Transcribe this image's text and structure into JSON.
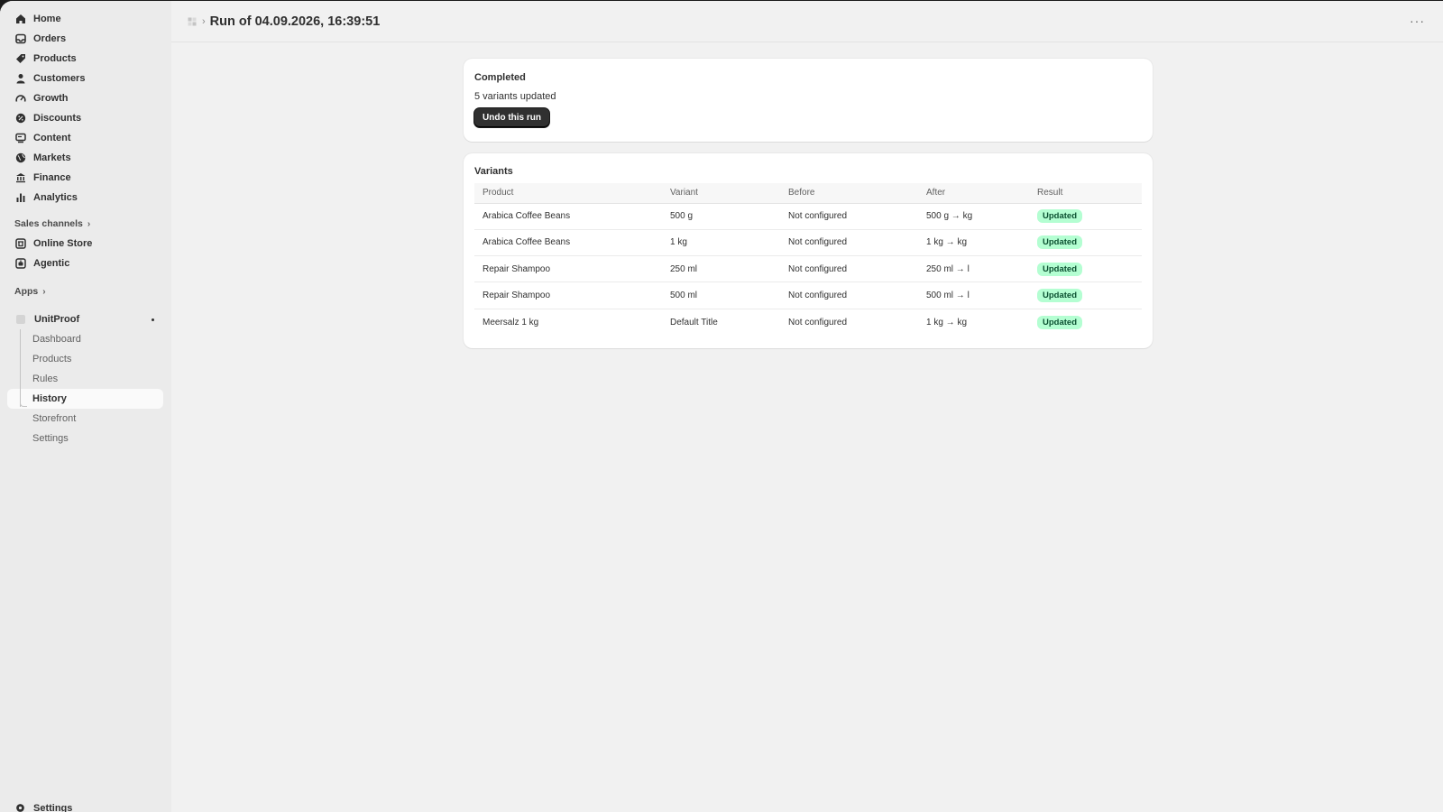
{
  "sidebar": {
    "nav": [
      {
        "label": "Home",
        "icon": "home-icon"
      },
      {
        "label": "Orders",
        "icon": "inbox-icon"
      },
      {
        "label": "Products",
        "icon": "tag-icon"
      },
      {
        "label": "Customers",
        "icon": "person-icon"
      },
      {
        "label": "Growth",
        "icon": "gauge-icon"
      },
      {
        "label": "Discounts",
        "icon": "discount-icon"
      },
      {
        "label": "Content",
        "icon": "content-icon"
      },
      {
        "label": "Markets",
        "icon": "globe-icon"
      },
      {
        "label": "Finance",
        "icon": "bank-icon"
      },
      {
        "label": "Analytics",
        "icon": "bar-chart-icon"
      }
    ],
    "sales_channels_label": "Sales channels",
    "channels": [
      {
        "label": "Online Store",
        "icon": "store-icon"
      },
      {
        "label": "Agentic",
        "icon": "agentic-icon"
      }
    ],
    "apps_label": "Apps",
    "app": {
      "name": "UnitProof",
      "items": [
        "Dashboard",
        "Products",
        "Rules",
        "History",
        "Storefront",
        "Settings"
      ],
      "active": "History"
    },
    "bottom_label": "Settings"
  },
  "header": {
    "title": "Run of 04.09.2026, 16:39:51",
    "more": "···"
  },
  "status_card": {
    "title": "Completed",
    "summary": "5 variants updated",
    "undo_label": "Undo this run"
  },
  "variants_card": {
    "title": "Variants",
    "columns": [
      "Product",
      "Variant",
      "Before",
      "After",
      "Result"
    ],
    "rows": [
      [
        "Arabica Coffee Beans",
        "500 g",
        "Not configured",
        "500 g → kg",
        "Updated"
      ],
      [
        "Arabica Coffee Beans",
        "1 kg",
        "Not configured",
        "1 kg → kg",
        "Updated"
      ],
      [
        "Repair Shampoo",
        "250 ml",
        "Not configured",
        "250 ml → l",
        "Updated"
      ],
      [
        "Repair Shampoo",
        "500 ml",
        "Not configured",
        "500 ml → l",
        "Updated"
      ],
      [
        "Meersalz 1 kg",
        "Default Title",
        "Not configured",
        "1 kg → kg",
        "Updated"
      ]
    ]
  },
  "colors": {
    "badge_bg": "#b4fed2",
    "badge_text": "#0c5132",
    "button_bg": "#303030"
  }
}
